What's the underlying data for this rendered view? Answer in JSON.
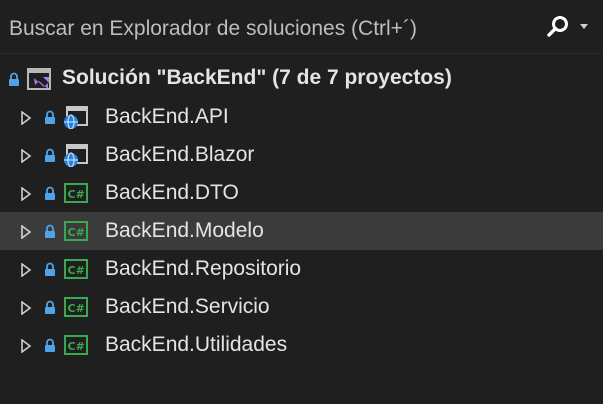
{
  "search": {
    "placeholder": "Buscar en Explorador de soluciones (Ctrl+´)",
    "icon": "search-icon"
  },
  "solution": {
    "label": "Solución \"BackEnd\"  (7 de 7 proyectos)",
    "icon": "visual-studio-solution-icon"
  },
  "projects": [
    {
      "name": "BackEnd.API",
      "icon": "web-project-icon",
      "selected": false
    },
    {
      "name": "BackEnd.Blazor",
      "icon": "web-project-icon",
      "selected": false
    },
    {
      "name": "BackEnd.DTO",
      "icon": "csharp-project-icon",
      "selected": false
    },
    {
      "name": "BackEnd.Modelo",
      "icon": "csharp-project-icon",
      "selected": true
    },
    {
      "name": "BackEnd.Repositorio",
      "icon": "csharp-project-icon",
      "selected": false
    },
    {
      "name": "BackEnd.Servicio",
      "icon": "csharp-project-icon",
      "selected": false
    },
    {
      "name": "BackEnd.Utilidades",
      "icon": "csharp-project-icon",
      "selected": false
    }
  ],
  "colors": {
    "background": "#1f1f1f",
    "selection": "#3b3b3b",
    "lock": "#4fa3e8",
    "csharp": "#39a850"
  }
}
